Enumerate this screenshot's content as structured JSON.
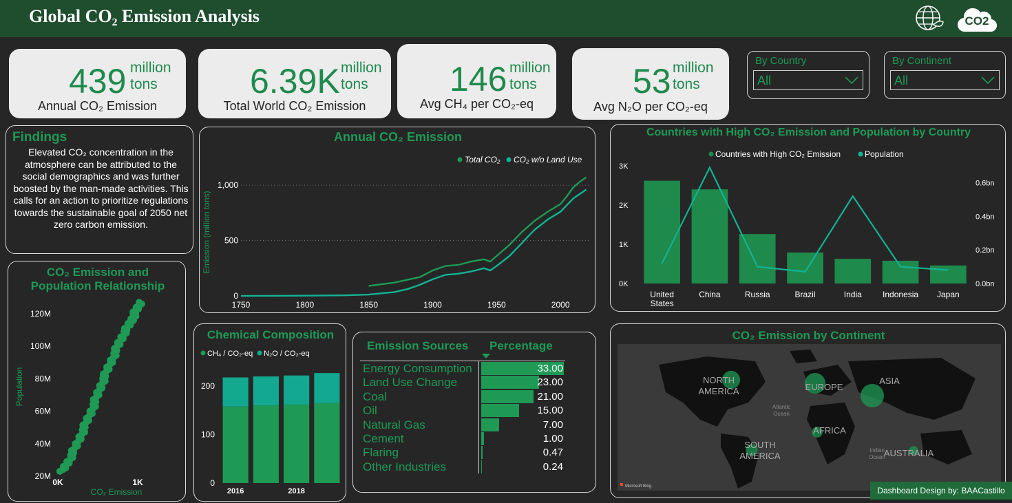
{
  "header": {
    "title": "Global CO₂ Emission Analysis"
  },
  "kpis": [
    {
      "value": "439",
      "unit1": "million",
      "unit2": "tons",
      "label": "Annual CO₂ Emission"
    },
    {
      "value": "6.39K",
      "unit1": "million",
      "unit2": "tons",
      "label": "Total World CO₂ Emission"
    },
    {
      "value": "146",
      "unit1": "million",
      "unit2": "tons",
      "label": "Avg CH₄ per CO₂-eq"
    },
    {
      "value": "53",
      "unit1": "million",
      "unit2": "tons",
      "label": "Avg N₂O per CO₂-eq"
    }
  ],
  "slicers": [
    {
      "label": "By Country",
      "value": "All"
    },
    {
      "label": "By Continent",
      "value": "All"
    }
  ],
  "findings": {
    "title": "Findings",
    "text": "Elevated CO₂ concentration in the atmosphere can be attributed to the social demographics and was further boosted by the man-made activities. This calls for an action to prioritize regulations towards the sustainable goal of 2050 net zero carbon emission."
  },
  "credit": "Dashboard Design by: BAACastillo",
  "map_attribution": "Microsoft Bing",
  "chart_data": [
    {
      "id": "annual",
      "type": "line",
      "title": "Annual CO₂ Emission",
      "ylabel": "Emission (million tons)",
      "xlim": [
        1750,
        2022
      ],
      "ylim": [
        0,
        1150
      ],
      "x_ticks": [
        "1750",
        "1800",
        "1850",
        "1900",
        "1950",
        "2000"
      ],
      "y_ticks": [
        "0",
        "500",
        "1,000"
      ],
      "series": [
        {
          "name": "Total CO₂",
          "color": "#1e9a55",
          "x": [
            1850,
            1870,
            1890,
            1900,
            1910,
            1920,
            1930,
            1940,
            1945,
            1950,
            1960,
            1970,
            1975,
            1980,
            1990,
            2000,
            2005,
            2010,
            2015,
            2020
          ],
          "y": [
            90,
            120,
            170,
            230,
            270,
            280,
            310,
            330,
            310,
            360,
            460,
            580,
            630,
            680,
            760,
            830,
            900,
            980,
            1030,
            1070
          ]
        },
        {
          "name": "CO₂ w/o Land Use",
          "color": "#13b394",
          "x": [
            1750,
            1800,
            1830,
            1850,
            1870,
            1880,
            1890,
            1900,
            1910,
            1920,
            1930,
            1940,
            1945,
            1950,
            1960,
            1970,
            1975,
            1980,
            1990,
            2000,
            2005,
            2010,
            2015,
            2020
          ],
          "y": [
            0,
            2,
            5,
            12,
            35,
            60,
            100,
            150,
            190,
            200,
            220,
            250,
            230,
            270,
            360,
            480,
            540,
            600,
            690,
            760,
            820,
            880,
            920,
            960
          ]
        }
      ]
    },
    {
      "id": "countries",
      "type": "bar",
      "title": "Countries with High CO₂ Emission and Population by Country",
      "categories": [
        "United States",
        "China",
        "Russia",
        "Brazil",
        "India",
        "Indonesia",
        "Japan"
      ],
      "y_ticks": [
        "0K",
        "1K",
        "2K",
        "3K"
      ],
      "y2_ticks": [
        "0.0bn",
        "0.2bn",
        "0.4bn",
        "0.6bn"
      ],
      "series": [
        {
          "name": "Countries with High CO₂ Emission",
          "color": "#1e8a4c",
          "values": [
            2620,
            2400,
            1260,
            790,
            630,
            580,
            460
          ]
        },
        {
          "name": "Population",
          "color": "#13b394",
          "values": [
            0.12,
            0.69,
            0.1,
            0.07,
            0.52,
            0.1,
            0.08
          ]
        }
      ]
    },
    {
      "id": "scatter",
      "type": "scatter",
      "title": "CO₂ Emission and Population Relationship",
      "xlabel": "CO₂ Emission",
      "ylabel": "Population",
      "x_ticks": [
        "0K",
        "1K"
      ],
      "y_ticks": [
        "20M",
        "40M",
        "60M",
        "80M",
        "100M",
        "120M"
      ],
      "trend": [
        [
          0.05,
          23
        ],
        [
          0.13,
          30
        ],
        [
          0.22,
          40
        ],
        [
          0.3,
          50
        ],
        [
          0.38,
          60
        ],
        [
          0.45,
          70
        ],
        [
          0.52,
          80
        ],
        [
          0.6,
          90
        ],
        [
          0.68,
          100
        ],
        [
          0.75,
          108
        ],
        [
          0.83,
          115
        ],
        [
          0.88,
          121
        ],
        [
          0.95,
          128
        ]
      ]
    },
    {
      "id": "chemical",
      "type": "bar",
      "title": "Chemical Composition",
      "categories": [
        "2016",
        "2017",
        "2018",
        "2019"
      ],
      "x_ticks": [
        "2016",
        "2018"
      ],
      "y_ticks": [
        "0",
        "100",
        "200"
      ],
      "ylim": [
        0,
        240
      ],
      "series": [
        {
          "name": "CH₄ / CO₂-eq",
          "color": "#1e9a55",
          "values": [
            158,
            160,
            162,
            165
          ]
        },
        {
          "name": "N₂O / CO₂-eq",
          "color": "#13a890",
          "values": [
            60,
            60,
            60,
            62
          ]
        }
      ]
    },
    {
      "id": "sources",
      "type": "table",
      "title": "Emission Sources",
      "columns": [
        "Emission Sources",
        "Percentage"
      ],
      "rows": [
        {
          "name": "Energy Consumption",
          "value": "33.00",
          "num": 33.0
        },
        {
          "name": "Land Use Change",
          "value": "23.00",
          "num": 23.0
        },
        {
          "name": "Coal",
          "value": "21.00",
          "num": 21.0
        },
        {
          "name": "Oil",
          "value": "15.00",
          "num": 15.0
        },
        {
          "name": "Natural Gas",
          "value": "7.00",
          "num": 7.0
        },
        {
          "name": "Cement",
          "value": "1.00",
          "num": 1.0
        },
        {
          "name": "Flaring",
          "value": "0.47",
          "num": 0.47
        },
        {
          "name": "Other Industries",
          "value": "0.24",
          "num": 0.24
        }
      ]
    },
    {
      "id": "continent",
      "type": "map",
      "title": "CO₂ Emission by Continent",
      "labels": [
        "NORTH",
        "AMERICA",
        "EUROPE",
        "ASIA",
        "AFRICA",
        "SOUTH",
        "AMERICA",
        "AUSTRALIA",
        "Atlantic",
        "Ocean",
        "Indian",
        "Ocean"
      ],
      "bubbles": [
        {
          "name": "North America",
          "size": 0.7
        },
        {
          "name": "Europe",
          "size": 0.85
        },
        {
          "name": "Asia",
          "size": 1.0
        },
        {
          "name": "Africa",
          "size": 0.3
        },
        {
          "name": "South America",
          "size": 0.35
        },
        {
          "name": "Australia",
          "size": 0.2
        }
      ]
    }
  ]
}
